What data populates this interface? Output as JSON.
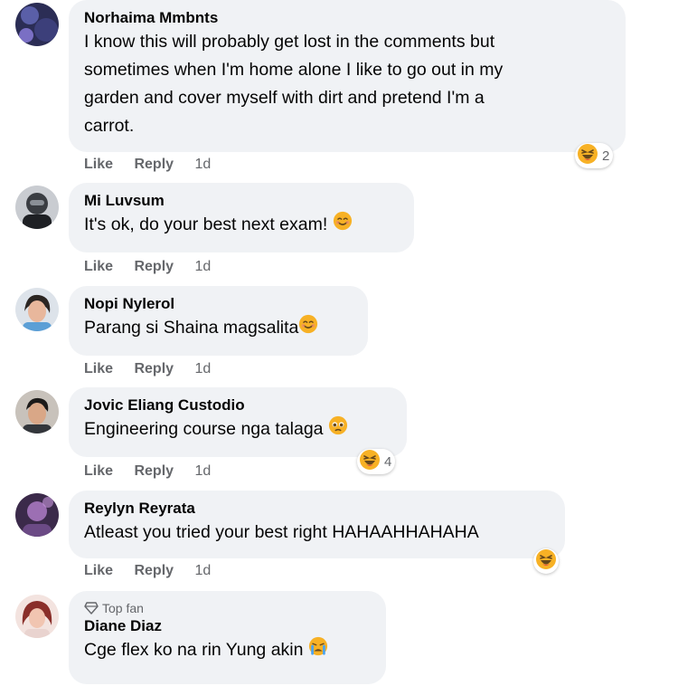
{
  "actions": {
    "like": "Like",
    "reply": "Reply"
  },
  "comments": [
    {
      "author": "Norhaima Mmbnts",
      "text_lines": [
        "I know this will probably get lost in the comments but",
        "sometimes when I'm home alone I like to go out in my",
        "garden and cover myself with dirt and pretend I'm a",
        "carrot."
      ],
      "time": "1d",
      "reaction": {
        "icon": "laughing-emoji-icon",
        "count": "2"
      }
    },
    {
      "author": "Mi Luvsum",
      "text": "It's ok, do your best next exam!",
      "inline_emoji": "smiling-emoji-icon",
      "time": "1d"
    },
    {
      "author": "Nopi Nylerol",
      "text": "Parang si Shaina magsalita",
      "inline_emoji": "smiling-emoji-icon",
      "time": "1d"
    },
    {
      "author": "Jovic Eliang Custodio",
      "text": "Engineering course nga talaga",
      "inline_emoji": "pleading-emoji-icon",
      "time": "1d",
      "reaction": {
        "icon": "laughing-emoji-icon",
        "count": "4"
      }
    },
    {
      "author": "Reylyn Reyrata",
      "text": "Atleast you tried your best right HAHAAHHAHAHA",
      "time": "1d",
      "reaction": {
        "icon": "laughing-emoji-icon",
        "count": ""
      }
    },
    {
      "badge": "Top fan",
      "author": "Diane Diaz",
      "text": "Cge flex ko na rin Yung akin",
      "inline_emoji": "crying-emoji-icon"
    }
  ]
}
